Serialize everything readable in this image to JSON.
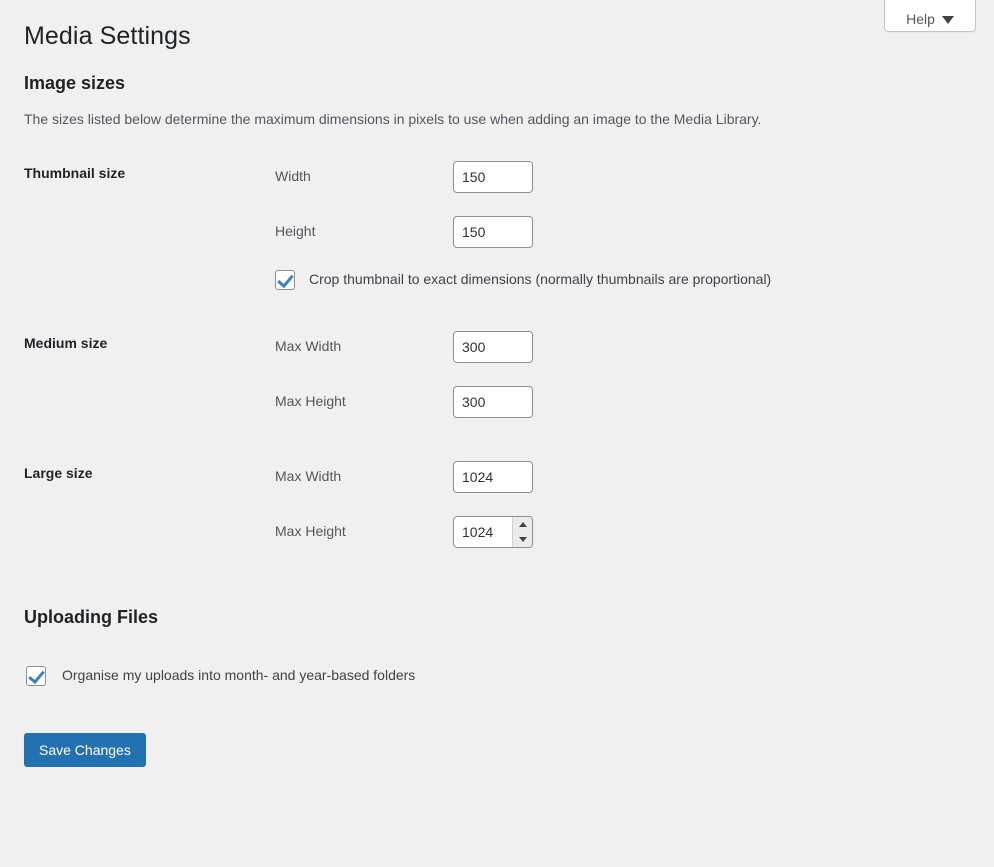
{
  "header": {
    "title": "Media Settings",
    "help_tab": {
      "label": "Help",
      "icon": "chevron-down-icon"
    }
  },
  "colors": {
    "page_background": "#f0f0f1",
    "accent_blue": "#2271b1",
    "checkbox_check": "#3582c4",
    "heading_text": "#1d2327",
    "body_text": "#3c434a",
    "muted_text": "#50575e",
    "input_border": "#8c8f94"
  },
  "image_sizes": {
    "heading": "Image sizes",
    "description": "The sizes listed below determine the maximum dimensions in pixels to use when adding an image to the Media Library.",
    "rows": [
      {
        "label": "Thumbnail size",
        "fields": [
          {
            "label": "Width",
            "value": "150",
            "spinner": false
          },
          {
            "label": "Height",
            "value": "150",
            "spinner": false
          }
        ],
        "checkbox": {
          "label": "Crop thumbnail to exact dimensions (normally thumbnails are proportional)",
          "checked": true
        }
      },
      {
        "label": "Medium size",
        "fields": [
          {
            "label": "Max Width",
            "value": "300",
            "spinner": false
          },
          {
            "label": "Max Height",
            "value": "300",
            "spinner": false
          }
        ]
      },
      {
        "label": "Large size",
        "fields": [
          {
            "label": "Max Width",
            "value": "1024",
            "spinner": false
          },
          {
            "label": "Max Height",
            "value": "1024",
            "spinner": true
          }
        ]
      }
    ]
  },
  "uploading_files": {
    "heading": "Uploading Files",
    "checkbox": {
      "label": "Organise my uploads into month- and year-based folders",
      "checked": true
    }
  },
  "submit": {
    "save_label": "Save Changes"
  }
}
